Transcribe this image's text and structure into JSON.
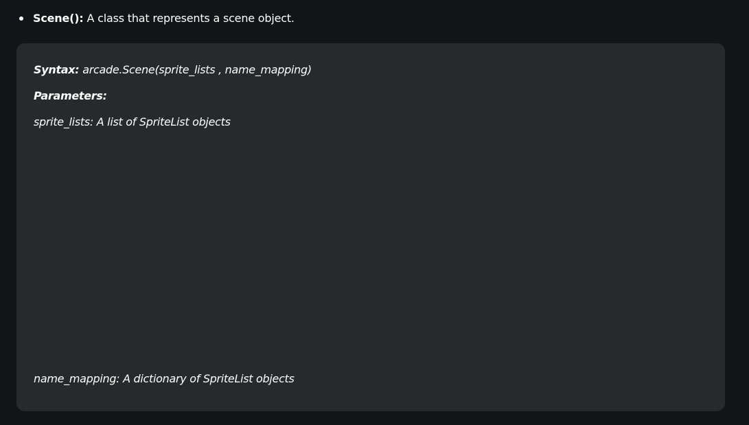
{
  "bullet": {
    "term": "Scene():",
    "description": "A class that represents a scene object."
  },
  "panel": {
    "syntax_label": "Syntax:",
    "syntax_value": "arcade.Scene(sprite_lists , name_mapping)",
    "parameters_label": "Parameters:",
    "param1": "sprite_lists: A list of SpriteList objects",
    "param2": "name_mapping: A dictionary of SpriteList objects"
  }
}
